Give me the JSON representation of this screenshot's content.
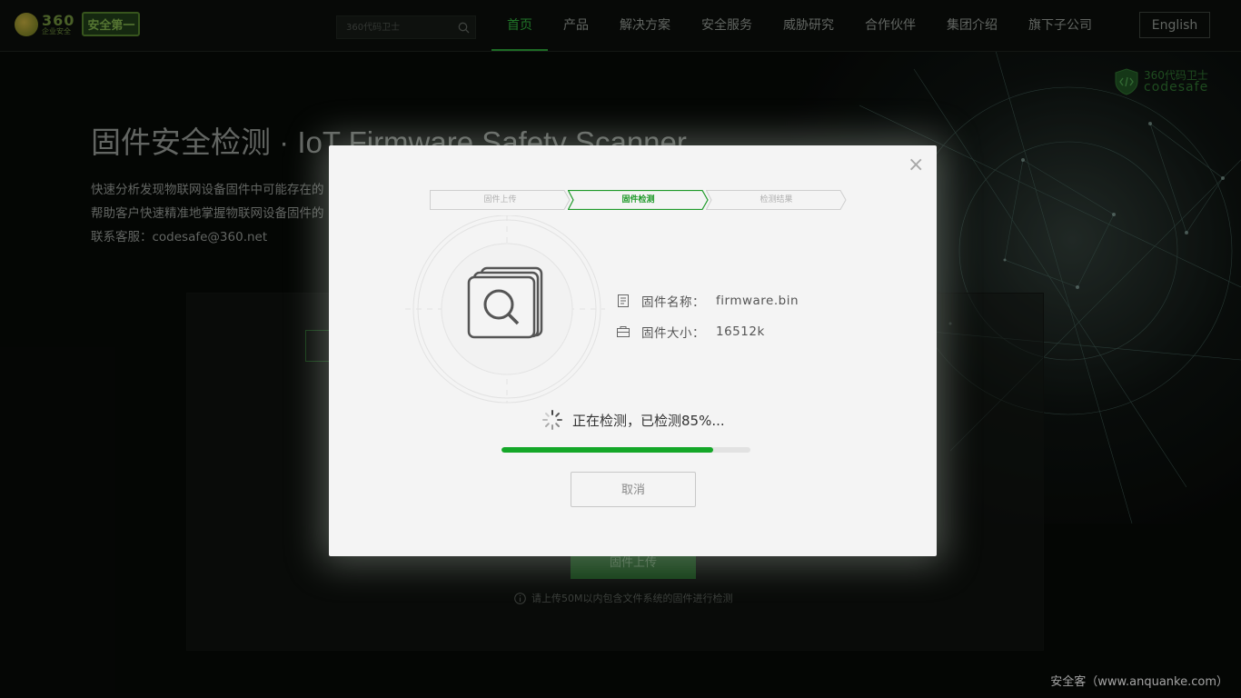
{
  "header": {
    "logo_number": "360",
    "logo_subtitle": "企业安全",
    "logo_badge": "安全第一",
    "search_placeholder": "360代码卫士",
    "nav": [
      {
        "label": "首页",
        "active": true
      },
      {
        "label": "产品",
        "active": false
      },
      {
        "label": "解决方案",
        "active": false
      },
      {
        "label": "安全服务",
        "active": false
      },
      {
        "label": "威胁研究",
        "active": false
      },
      {
        "label": "合作伙伴",
        "active": false
      },
      {
        "label": "集团介绍",
        "active": false
      },
      {
        "label": "旗下子公司",
        "active": false
      }
    ],
    "language_button": "English"
  },
  "codesafe_logo": {
    "cn": "360代码卫士",
    "en": "codesafe"
  },
  "hero": {
    "title": "固件安全检测 · IoT Firmware Safety Scanner",
    "desc_lines": [
      "快速分析发现物联网设备固件中可能存在的",
      "帮助客户快速精准地掌握物联网设备固件的",
      "联系客服：codesafe@360.net"
    ]
  },
  "upload": {
    "button_label": "固件上传",
    "tip": "请上传50M以内包含文件系统的固件进行检测"
  },
  "modal": {
    "close_glyph": "×",
    "steps": [
      {
        "label": "固件上传",
        "state": "done"
      },
      {
        "label": "固件检测",
        "state": "active"
      },
      {
        "label": "检测结果",
        "state": "todo"
      }
    ],
    "file_name_label": "固件名称：",
    "file_name_value": "firmware.bin",
    "file_size_label": "固件大小：",
    "file_size_value": "16512k",
    "status_text": "正在检测，已检测85%...",
    "progress_percent": 85,
    "cancel_label": "取消"
  },
  "footer_credit": "安全客（www.anquanke.com）",
  "colors": {
    "accent_green": "#14a728",
    "nav_active": "#2ea83a",
    "background": "#070907",
    "modal_bg": "#f4f4f4"
  },
  "icons": [
    "search-icon",
    "shield-code-icon",
    "folder-search-icon",
    "file-icon",
    "size-icon",
    "loading-spinner-icon",
    "info-icon",
    "close-icon"
  ]
}
